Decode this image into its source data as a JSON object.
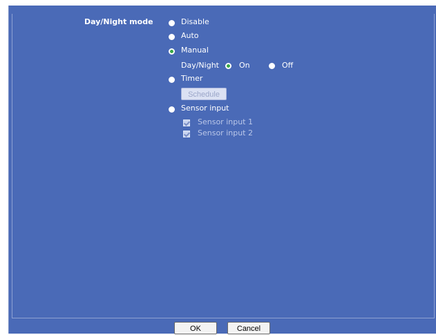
{
  "form": {
    "day_night_label": "Day/Night mode",
    "options": {
      "disable": "Disable",
      "auto": "Auto",
      "manual": "Manual",
      "timer": "Timer",
      "sensor_input": "Sensor input"
    },
    "selected_mode": "Manual",
    "manual": {
      "label": "Day/Night",
      "on": "On",
      "off": "Off",
      "selected": "On"
    },
    "schedule_button": "Schedule",
    "sensor_inputs": [
      "Sensor input 1",
      "Sensor input 2"
    ]
  },
  "footer": {
    "ok_label": "OK",
    "cancel_label": "Cancel"
  },
  "colors": {
    "panel_bg": "#4a6ab7",
    "selected_radio": "#39a846"
  }
}
